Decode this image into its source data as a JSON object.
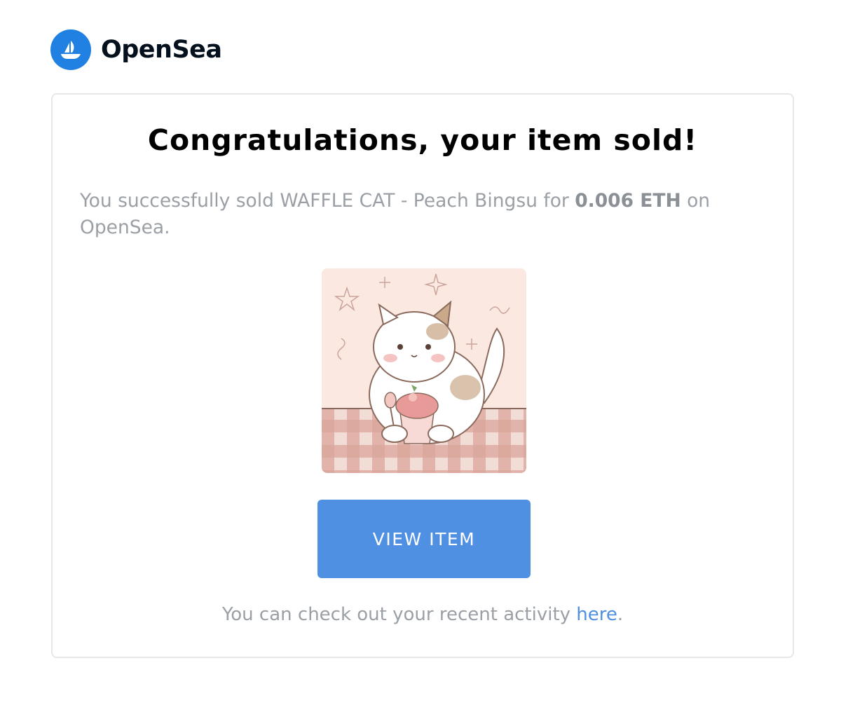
{
  "brand": {
    "name": "OpenSea",
    "logo_icon": "opensea-boat-logo",
    "color": "#2081e2"
  },
  "email": {
    "headline": "Congratulations, your item sold!",
    "message_prefix": "You successfully sold WAFFLE CAT - Peach Bingsu for ",
    "amount": "0.006 ETH",
    "message_suffix": " on OpenSea.",
    "item_image_icon": "waffle-cat-peach-bingsu-artwork",
    "button_label": "VIEW ITEM",
    "button_color": "#4f90e2",
    "footer_prefix": "You can check out your recent activity ",
    "footer_link": "here",
    "footer_suffix": "."
  }
}
